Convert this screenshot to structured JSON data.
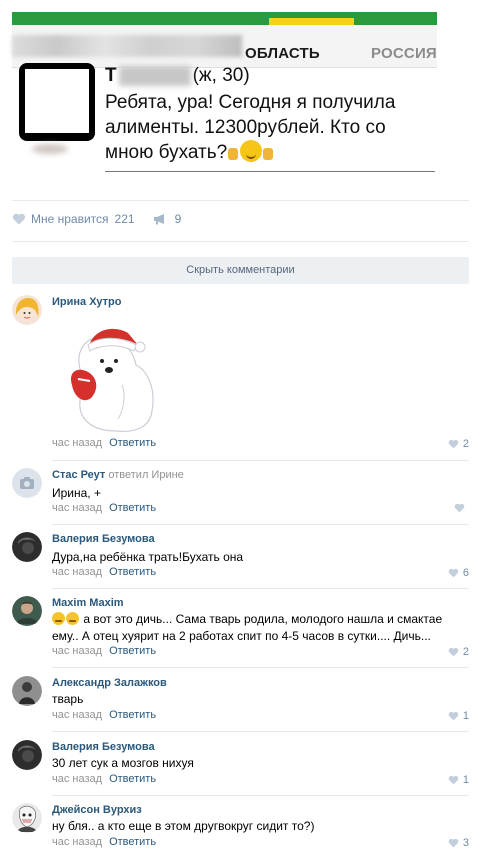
{
  "post": {
    "tab_region": "ОБЛАСТЬ",
    "tab_russia": "РОССИЯ",
    "author_initial": "Т",
    "author_meta": "(ж, 30)",
    "text": "Ребята, ура! Сегодня я получила алименты. 12300рублей. Кто со мною бухать?"
  },
  "actions": {
    "like_label": "Мне нравится",
    "like_count": "221",
    "share_count": "9"
  },
  "hide_comments_label": "Скрыть комментарии",
  "colors": {
    "link": "#2b587a",
    "muted": "#939393",
    "accent_green": "#2a9a3c",
    "accent_yellow": "#f1d21f"
  },
  "comments": [
    {
      "name": "Ирина Хутро",
      "replied": "",
      "text": "",
      "time": "час назад",
      "reply": "Ответить",
      "likes": "2",
      "has_sticker": true
    },
    {
      "name": "Стас Реут",
      "replied": "ответил Ирине",
      "text": "Ирина, +",
      "time": "час назад",
      "reply": "Ответить",
      "likes": ""
    },
    {
      "name": "Валерия Безумова",
      "replied": "",
      "text": "Дура,на ребёнка трать!Бухать она",
      "time": "час назад",
      "reply": "Ответить",
      "likes": "6"
    },
    {
      "name": "Maxim Maxim",
      "replied": "",
      "text": "а вот это дичь... Сама тварь родила, молодого нашла и смактае ему.. А отец хуярит на 2 работах спит по 4-5 часов в сутки.... Дичь...",
      "time": "час назад",
      "reply": "Ответить",
      "likes": "2"
    },
    {
      "name": "Александр Залажков",
      "replied": "",
      "text": "тварь",
      "time": "час назад",
      "reply": "Ответить",
      "likes": "1"
    },
    {
      "name": "Валерия Безумова",
      "replied": "",
      "text": "30 лет сук а мозгов нихуя",
      "time": "час назад",
      "reply": "Ответить",
      "likes": "1"
    },
    {
      "name": "Джейсон Вурхиз",
      "replied": "",
      "text": "ну бля.. а кто еще в этом другвокруг сидит то?)",
      "time": "час назад",
      "reply": "Ответить",
      "likes": "3"
    }
  ]
}
